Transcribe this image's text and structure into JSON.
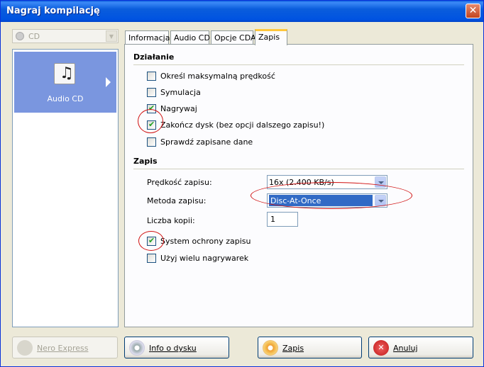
{
  "window": {
    "title": "Nagraj kompilację",
    "close_glyph": "✕"
  },
  "left": {
    "combo": {
      "value": "CD",
      "arrow_glyph": "▼"
    },
    "items": [
      {
        "label": "Audio CD",
        "icon": "audio-cd-icon",
        "note_glyph": "♫"
      }
    ]
  },
  "tabs": [
    {
      "label": "Informacja"
    },
    {
      "label": "Audio CD"
    },
    {
      "label": "Opcje CDA"
    },
    {
      "label": "Zapis",
      "active": true
    }
  ],
  "dzialanie": {
    "title": "Działanie",
    "options": [
      {
        "label": "Określ maksymalną prędkość",
        "checked": false
      },
      {
        "label": "Symulacja",
        "checked": false
      },
      {
        "label": "Nagrywaj",
        "checked": true
      },
      {
        "label": "Zakończ dysk (bez opcji dalszego zapisu!)",
        "checked": true
      },
      {
        "label": "Sprawdź zapisane dane",
        "checked": false
      }
    ]
  },
  "zapis": {
    "title": "Zapis",
    "speed_label": "Prędkość zapisu:",
    "speed_value": "16x (2.400 KB/s)",
    "method_label": "Metoda zapisu:",
    "method_value": "Disc-At-Once",
    "copies_label": "Liczba kopii:",
    "copies_value": "1",
    "options": [
      {
        "label": "System ochrony zapisu",
        "checked": true
      },
      {
        "label": "Użyj wielu nagrywarek",
        "checked": false
      }
    ]
  },
  "buttons": {
    "nero_express": {
      "label_first": "N",
      "label_rest": "ero Express",
      "disabled": true
    },
    "info": {
      "label_first": "I",
      "label_rest": "nfo o dysku"
    },
    "zapis": {
      "label_first": "Z",
      "label_rest": "apis"
    },
    "anuluj": {
      "label_first": "A",
      "label_rest": "nuluj"
    }
  },
  "colors": {
    "title_bar": "#0a5ddc",
    "selection": "#316ac5",
    "annotation": "#d01010",
    "left_item": "#7a96df"
  }
}
